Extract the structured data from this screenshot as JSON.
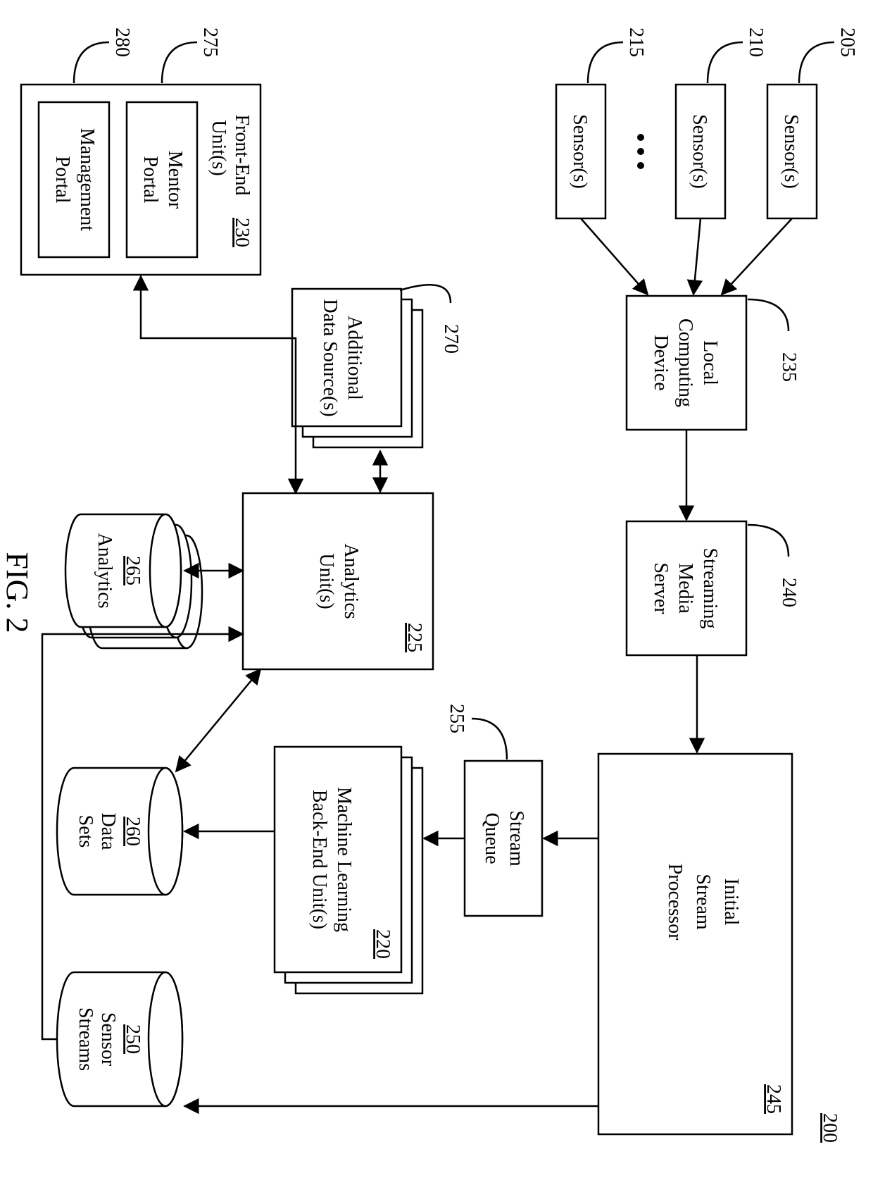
{
  "figure": {
    "caption": "FIG. 2",
    "overall_ref": "200"
  },
  "nodes": {
    "sensors1": {
      "label": "Sensor(s)",
      "ref": "205"
    },
    "sensors2": {
      "label": "Sensor(s)",
      "ref": "210"
    },
    "sensors3": {
      "label": "Sensor(s)",
      "ref": "215"
    },
    "local_dev": {
      "label1": "Local",
      "label2": "Computing",
      "label3": "Device",
      "ref": "235"
    },
    "media_srv": {
      "label1": "Streaming",
      "label2": "Media",
      "label3": "Server",
      "ref": "240"
    },
    "init_proc": {
      "label1": "Initial",
      "label2": "Stream",
      "label3": "Processor",
      "ref": "245"
    },
    "queue": {
      "label1": "Stream",
      "label2": "Queue",
      "ref": "255"
    },
    "ml_unit": {
      "label1": "Machine Learning",
      "label2": "Back-End Unit(s)",
      "ref": "220"
    },
    "add_src": {
      "label1": "Additional",
      "label2": "Data Source(s)",
      "ref": "270"
    },
    "analytics_u": {
      "label1": "Analytics",
      "label2": "Unit(s)",
      "ref": "225"
    },
    "analytics_db": {
      "label": "Analytics",
      "ref": "265"
    },
    "data_sets": {
      "label1": "Data",
      "label2": "Sets",
      "ref": "260"
    },
    "streams_db": {
      "label1": "Sensor",
      "label2": "Streams",
      "ref": "250"
    },
    "frontend": {
      "label1": "Front-End",
      "label2": "Unit(s)",
      "ref": "230"
    },
    "mentor": {
      "label1": "Mentor",
      "label2": "Portal",
      "ref": "275"
    },
    "mgmt": {
      "label1": "Management",
      "label2": "Portal",
      "ref": "280"
    }
  }
}
